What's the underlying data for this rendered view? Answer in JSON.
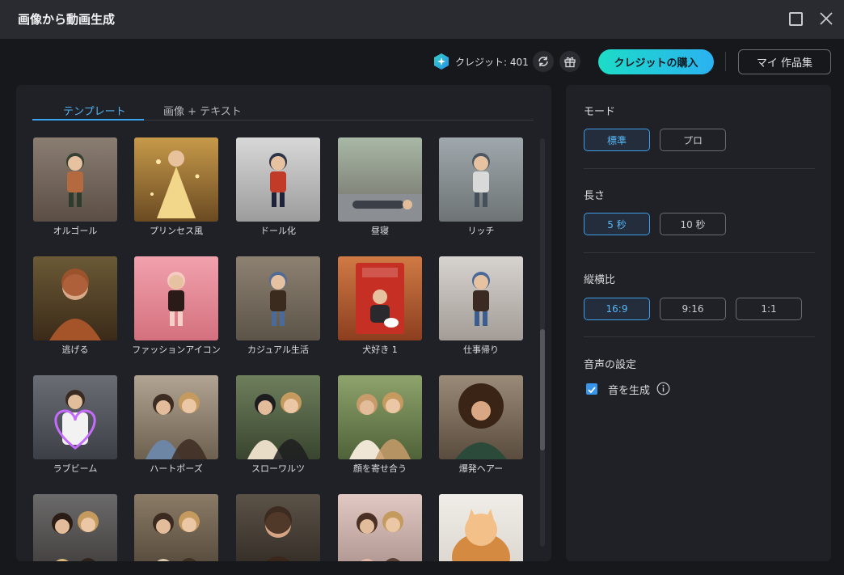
{
  "window": {
    "title": "画像から動画生成"
  },
  "toolbar": {
    "credits_label": "クレジット: 401",
    "buy_button": "クレジットの購入",
    "my_works_button": "マイ 作品集"
  },
  "tabs": [
    {
      "label": "テンプレート",
      "active": true
    },
    {
      "label": "画像 + テキスト",
      "active": false
    }
  ],
  "templates": [
    {
      "label": "オルゴール",
      "icon": "music-box-figure-thumbnail"
    },
    {
      "label": "プリンセス風",
      "icon": "princess-gown-thumbnail"
    },
    {
      "label": "ドール化",
      "icon": "doll-figure-thumbnail"
    },
    {
      "label": "昼寝",
      "icon": "road-nap-thumbnail"
    },
    {
      "label": "リッチ",
      "icon": "money-rain-thumbnail"
    },
    {
      "label": "逃げる",
      "icon": "painting-portrait-thumbnail"
    },
    {
      "label": "ファッションアイコン",
      "icon": "doll-box-thumbnail"
    },
    {
      "label": "カジュアル生活",
      "icon": "casual-figure-thumbnail"
    },
    {
      "label": "犬好き 1",
      "icon": "sport-dog-figure-thumbnail"
    },
    {
      "label": "仕事帰り",
      "icon": "office-figure-thumbnail"
    },
    {
      "label": "ラブビーム",
      "icon": "heart-beam-thumbnail"
    },
    {
      "label": "ハートポーズ",
      "icon": "heart-pose-thumbnail"
    },
    {
      "label": "スローワルツ",
      "icon": "waltz-couple-thumbnail"
    },
    {
      "label": "顔を寄せ合う",
      "icon": "cheek-together-thumbnail"
    },
    {
      "label": "爆発ヘアー",
      "icon": "big-hair-thumbnail"
    },
    {
      "label": "",
      "icon": "street-lights-thumbnail"
    },
    {
      "label": "",
      "icon": "hug-thumbnail"
    },
    {
      "label": "",
      "icon": "smiling-woman-thumbnail"
    },
    {
      "label": "",
      "icon": "selfie-thumbnail"
    },
    {
      "label": "",
      "icon": "cat-thumbnail"
    }
  ],
  "settings": {
    "mode": {
      "title": "モード",
      "options": [
        {
          "label": "標準",
          "selected": true
        },
        {
          "label": "プロ",
          "selected": false
        }
      ]
    },
    "length": {
      "title": "長さ",
      "options": [
        {
          "label": "5 秒",
          "selected": true
        },
        {
          "label": "10 秒",
          "selected": false
        }
      ]
    },
    "aspect": {
      "title": "縦横比",
      "options": [
        {
          "label": "16:9",
          "selected": true
        },
        {
          "label": "9:16",
          "selected": false
        },
        {
          "label": "1:1",
          "selected": false
        }
      ]
    },
    "audio": {
      "title": "音声の設定",
      "checkbox_label": "音を生成",
      "checked": true
    }
  },
  "colors": {
    "accent": "#3aa4f0",
    "buy_gradient_start": "#1ddcc7",
    "buy_gradient_end": "#2bb2f1",
    "panel": "#202126",
    "background": "#17181c"
  }
}
